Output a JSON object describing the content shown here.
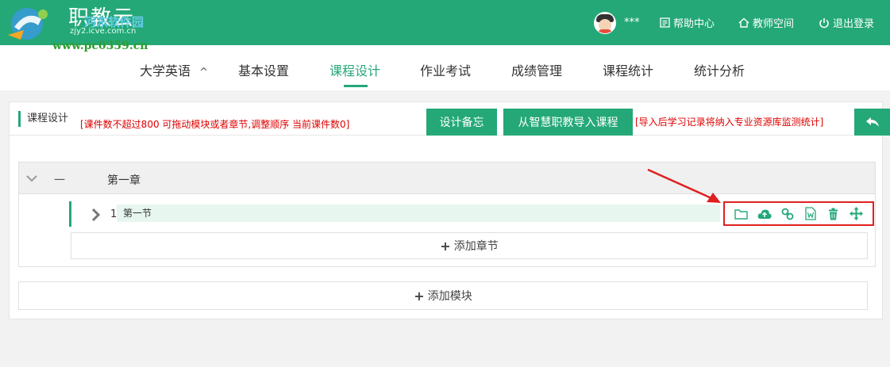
{
  "logo": {
    "title": "职教云",
    "subtitle": "zjy2.icve.com.cn"
  },
  "watermark": {
    "site": "河东软件园",
    "url": "www.pc0359.cn"
  },
  "user": {
    "name": "***"
  },
  "topnav": {
    "help": "帮助中心",
    "teacher_space": "教师空间",
    "logout": "退出登录"
  },
  "nav": {
    "course_name": "大学英语",
    "caret": "^",
    "items": [
      "基本设置",
      "课程设计",
      "作业考试",
      "成绩管理",
      "课程统计",
      "统计分析"
    ],
    "active": "课程设计"
  },
  "header": {
    "title": "课程设计",
    "note": "[课件数不超过800 可拖动模块或者章节,调整顺序 当前课件数0]",
    "memo_button": "设计备忘",
    "import_button": "从智慧职教导入课程",
    "import_note": "[导入后学习记录将纳入专业资源库监测统计]"
  },
  "module": {
    "number": "一",
    "name": "第一章"
  },
  "section": {
    "number": "1",
    "name": "第一节"
  },
  "tools": [
    "folder-icon",
    "cloud-upload-icon",
    "link-icon",
    "word-doc-icon",
    "trash-icon",
    "move-icon"
  ],
  "add_chapter": "添加章节",
  "add_module": "添加模块",
  "colors": {
    "brand": "#24a878",
    "warning": "#e00000",
    "highlight": "#e02020"
  }
}
